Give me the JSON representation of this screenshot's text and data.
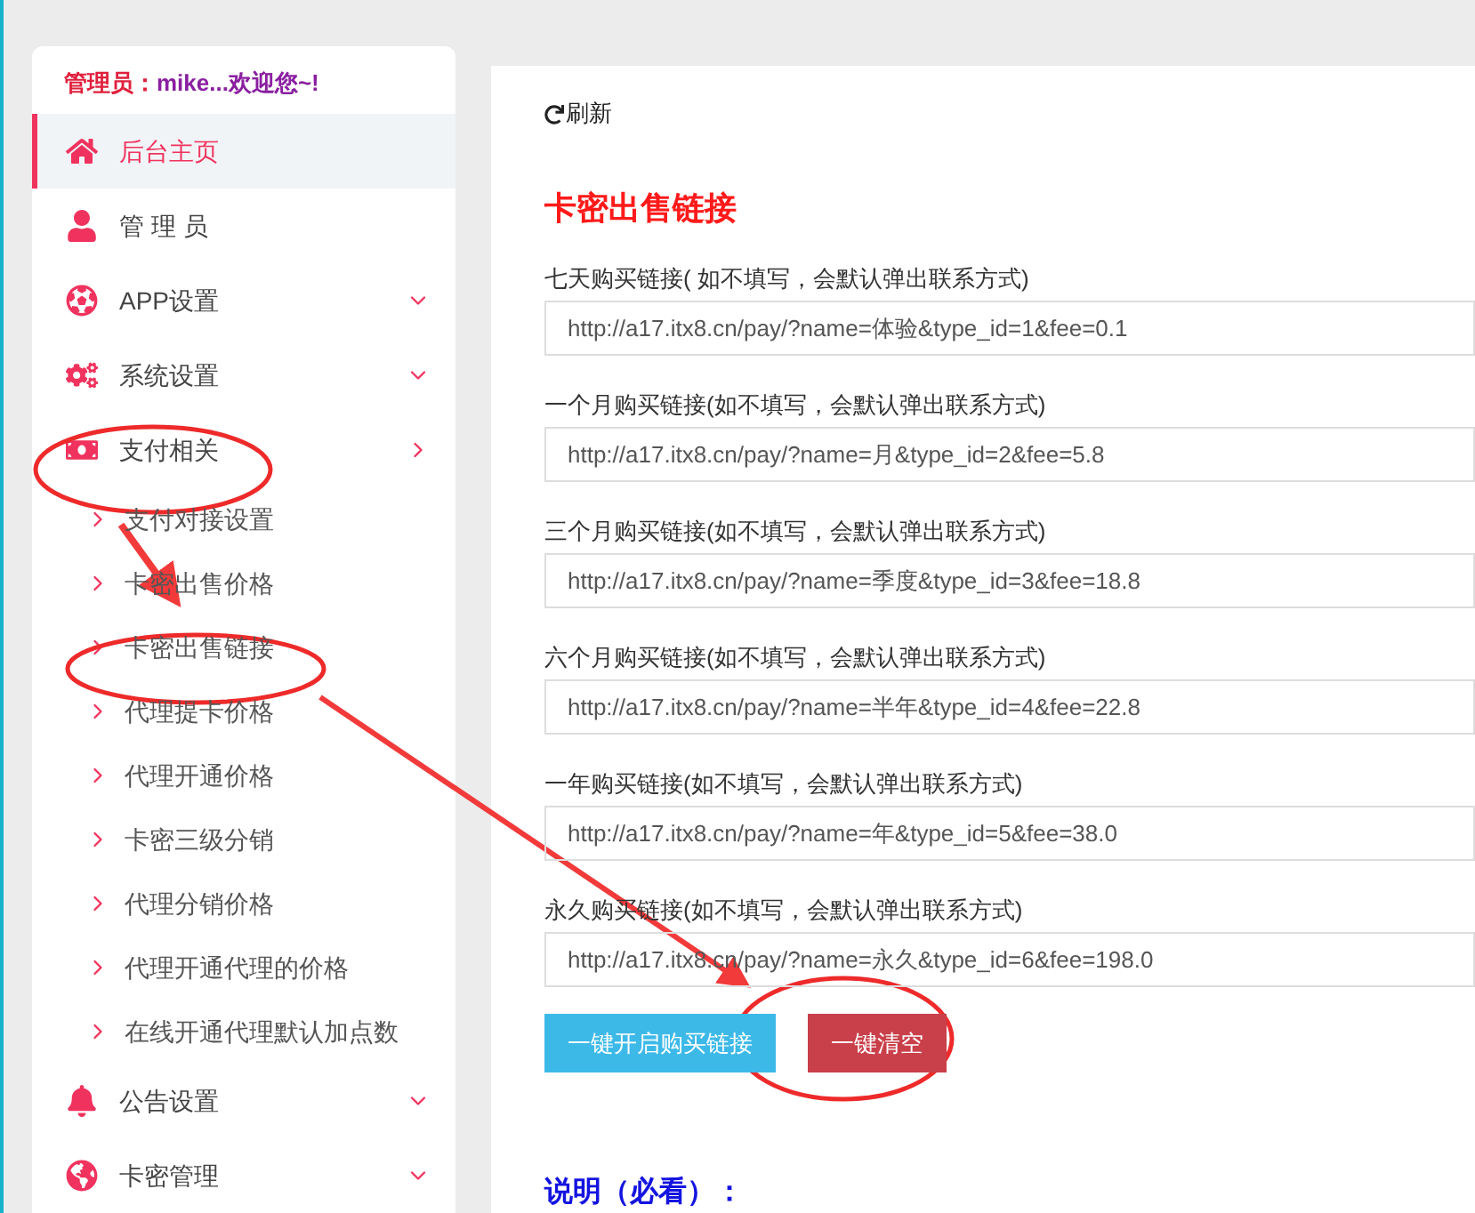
{
  "sidebar": {
    "greeting": {
      "role": "管理员：",
      "user": "mike...欢迎您~!"
    },
    "items": [
      {
        "label": "后台主页",
        "selected": true
      },
      {
        "label": "管 理 员",
        "selected": false
      },
      {
        "label": "APP设置",
        "selected": false,
        "expanded": false
      },
      {
        "label": "系统设置",
        "selected": false,
        "expanded": false
      },
      {
        "label": "支付相关",
        "selected": false,
        "expanded": true,
        "children": [
          {
            "label": "支付对接设置"
          },
          {
            "label": "卡密出售价格"
          },
          {
            "label": "卡密出售链接"
          },
          {
            "label": "代理提卡价格"
          },
          {
            "label": "代理开通价格"
          },
          {
            "label": "卡密三级分销"
          },
          {
            "label": "代理分销价格"
          },
          {
            "label": "代理开通代理的价格"
          },
          {
            "label": "在线开通代理默认加点数"
          }
        ]
      },
      {
        "label": "公告设置",
        "selected": false,
        "expanded": false
      },
      {
        "label": "卡密管理",
        "selected": false,
        "expanded": false
      }
    ]
  },
  "main": {
    "refresh": "刷新",
    "title": "卡密出售链接",
    "fields": [
      {
        "label": "七天购买链接( 如不填写，会默认弹出联系方式)",
        "value": "http://a17.itx8.cn/pay/?name=体验&type_id=1&fee=0.1"
      },
      {
        "label": "一个月购买链接(如不填写，会默认弹出联系方式)",
        "value": "http://a17.itx8.cn/pay/?name=月&type_id=2&fee=5.8"
      },
      {
        "label": "三个月购买链接(如不填写，会默认弹出联系方式)",
        "value": "http://a17.itx8.cn/pay/?name=季度&type_id=3&fee=18.8"
      },
      {
        "label": "六个月购买链接(如不填写，会默认弹出联系方式)",
        "value": "http://a17.itx8.cn/pay/?name=半年&type_id=4&fee=22.8"
      },
      {
        "label": "一年购买链接(如不填写，会默认弹出联系方式)",
        "value": "http://a17.itx8.cn/pay/?name=年&type_id=5&fee=38.0"
      },
      {
        "label": "永久购买链接(如不填写，会默认弹出联系方式)",
        "value": "http://a17.itx8.cn/pay/?name=永久&type_id=6&fee=198.0"
      }
    ],
    "buttons": [
      {
        "label": "一键开启购买链接",
        "kind": "primary"
      },
      {
        "label": "一键清空",
        "kind": "danger"
      }
    ],
    "note_heading": "说明（必看）："
  }
}
